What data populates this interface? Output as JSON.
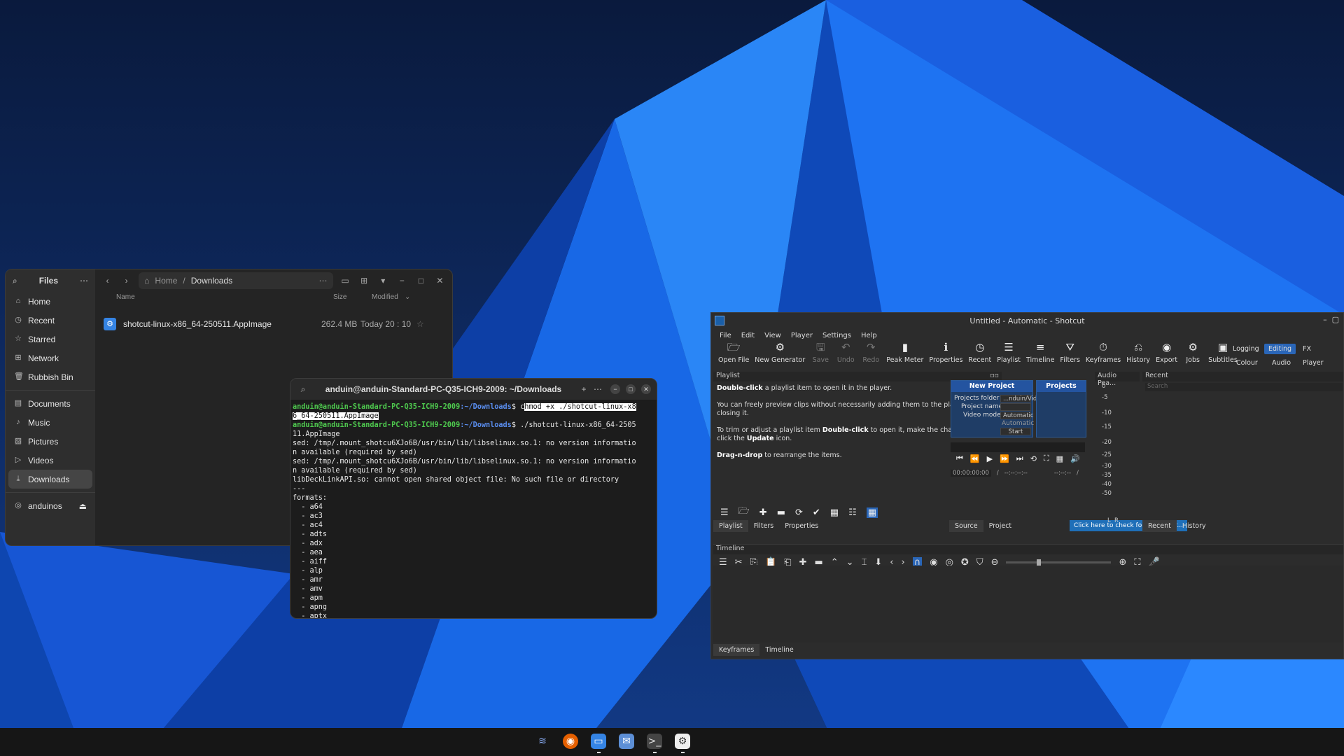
{
  "colors": {
    "accent": "#3584e4",
    "prompt_green": "#4ec94e",
    "path_blue": "#5a8ef0",
    "shotcut_active": "#2a66b8"
  },
  "files": {
    "title": "Files",
    "sidebar": [
      {
        "label": "Home",
        "icon": "home-icon",
        "glyph": "⌂"
      },
      {
        "label": "Recent",
        "icon": "clock-icon",
        "glyph": "◷"
      },
      {
        "label": "Starred",
        "icon": "star-icon",
        "glyph": "☆"
      },
      {
        "label": "Network",
        "icon": "network-icon",
        "glyph": "⊞"
      },
      {
        "label": "Rubbish Bin",
        "icon": "trash-icon",
        "glyph": "🗑"
      },
      {
        "label": "Documents",
        "icon": "document-icon",
        "glyph": "▤"
      },
      {
        "label": "Music",
        "icon": "music-icon",
        "glyph": "♪"
      },
      {
        "label": "Pictures",
        "icon": "picture-icon",
        "glyph": "▨"
      },
      {
        "label": "Videos",
        "icon": "video-icon",
        "glyph": "▷"
      },
      {
        "label": "Downloads",
        "icon": "download-icon",
        "glyph": "⤓"
      },
      {
        "label": "anduinos",
        "icon": "drive-icon",
        "glyph": "◎"
      }
    ],
    "path": {
      "home": "Home",
      "sep": "/",
      "current": "Downloads"
    },
    "columns": {
      "name": "Name",
      "size": "Size",
      "modified": "Modified"
    },
    "file": {
      "name": "shotcut-linux-x86_64-250511.AppImage",
      "size": "262.4 MB",
      "modified": "Today 20 : 10"
    }
  },
  "terminal": {
    "title": "anduin@anduin-Standard-PC-Q35-ICH9-2009: ~/Downloads",
    "prompt": "anduin@anduin-Standard-PC-Q35-ICH9-2009",
    "dir": ":~/Downloads",
    "cmd1_a": "c",
    "cmd1_b": "hmod +x ./shotcut-linux-x8",
    "cmd1_c": "6_64-250511.AppImage",
    "cmd2": "./shotcut-linux-x86_64-2505",
    "cmd2_cont": "11.AppImage",
    "output": [
      "sed: /tmp/.mount_shotcu6XJo6B/usr/bin/lib/libselinux.so.1: no version informatio",
      "n available (required by sed)",
      "sed: /tmp/.mount_shotcu6XJo6B/usr/bin/lib/libselinux.so.1: no version informatio",
      "n available (required by sed)",
      "libDeckLinkAPI.so: cannot open shared object file: No such file or directory",
      "---",
      "formats:",
      "  - a64",
      "  - ac3",
      "  - ac4",
      "  - adts",
      "  - adx",
      "  - aea",
      "  - aiff",
      "  - alp",
      "  - amr",
      "  - amv",
      "  - apm",
      "  - apng",
      "  - aptx"
    ]
  },
  "shotcut": {
    "title": "Untitled - Automatic - Shotcut",
    "menu": [
      "File",
      "Edit",
      "View",
      "Player",
      "Settings",
      "Help"
    ],
    "tools": [
      {
        "label": "Open File",
        "icon": "folder-open-icon",
        "glyph": "🗁"
      },
      {
        "label": "New Generator",
        "icon": "generator-icon",
        "glyph": "⚙"
      },
      {
        "label": "Save",
        "icon": "save-icon",
        "glyph": "🖫"
      },
      {
        "label": "Undo",
        "icon": "undo-icon",
        "glyph": "↶"
      },
      {
        "label": "Redo",
        "icon": "redo-icon",
        "glyph": "↷"
      },
      {
        "label": "Peak Meter",
        "icon": "peak-meter-icon",
        "glyph": "▮"
      },
      {
        "label": "Properties",
        "icon": "info-icon",
        "glyph": "ℹ"
      },
      {
        "label": "Recent",
        "icon": "recent-icon",
        "glyph": "◷"
      },
      {
        "label": "Playlist",
        "icon": "playlist-icon",
        "glyph": "☰"
      },
      {
        "label": "Timeline",
        "icon": "timeline-icon",
        "glyph": "≡"
      },
      {
        "label": "Filters",
        "icon": "filter-icon",
        "glyph": "⛛"
      },
      {
        "label": "Keyframes",
        "icon": "keyframes-icon",
        "glyph": "⏱"
      },
      {
        "label": "History",
        "icon": "history-icon",
        "glyph": "⎌"
      },
      {
        "label": "Export",
        "icon": "export-icon",
        "glyph": "◉"
      },
      {
        "label": "Jobs",
        "icon": "jobs-icon",
        "glyph": "⚙"
      },
      {
        "label": "Subtitles",
        "icon": "subtitles-icon",
        "glyph": "▣"
      }
    ],
    "layouts": {
      "logging": "Logging",
      "editing": "Editing",
      "fx": "FX",
      "colour": "Colour",
      "audio": "Audio",
      "player": "Player"
    },
    "playlist": {
      "header": "Playlist",
      "p1_b": "Double-click",
      "p1": " a playlist item to open it in the player.",
      "p2": "You can freely preview clips without necessarily adding them to the playlist or closing it.",
      "p3a": "To trim or adjust a playlist item ",
      "p3_b": "Double-click",
      "p3b": " to open it, make the changes, and click the ",
      "p3_c": "Update",
      "p3c": " icon.",
      "p4_b": "Drag-n-drop",
      "p4": " to rearrange the items.",
      "tabs": [
        "Playlist",
        "Filters",
        "Properties"
      ]
    },
    "new_project": {
      "header": "New Project",
      "folder_label": "Projects folder",
      "folder_value": "...nduin/Videos",
      "name_label": "Project name",
      "mode_label": "Video mode",
      "mode_value": "Automatic",
      "mode_sub": "Automatic",
      "start": "Start"
    },
    "projects": "Projects",
    "player": {
      "time": "00:00:00:00",
      "sep": "/",
      "dur": "--:--:--:--",
      "in": "--:--:--",
      "slash": "/"
    },
    "source_tabs": [
      "Source",
      "Project"
    ],
    "update_btn": "Click here to check for a new ver...",
    "audio": {
      "header": "Audio Pea...",
      "levels": [
        "0",
        "-5",
        "-10",
        "-15",
        "-20",
        "-25",
        "-30",
        "-35",
        "-40",
        "-50"
      ],
      "l": "L",
      "r": "R"
    },
    "recent": {
      "header": "Recent",
      "search": "Search",
      "tabs": [
        "Recent",
        "History"
      ]
    },
    "timeline": {
      "header": "Timeline",
      "tabs": [
        "Keyframes",
        "Timeline"
      ]
    }
  }
}
